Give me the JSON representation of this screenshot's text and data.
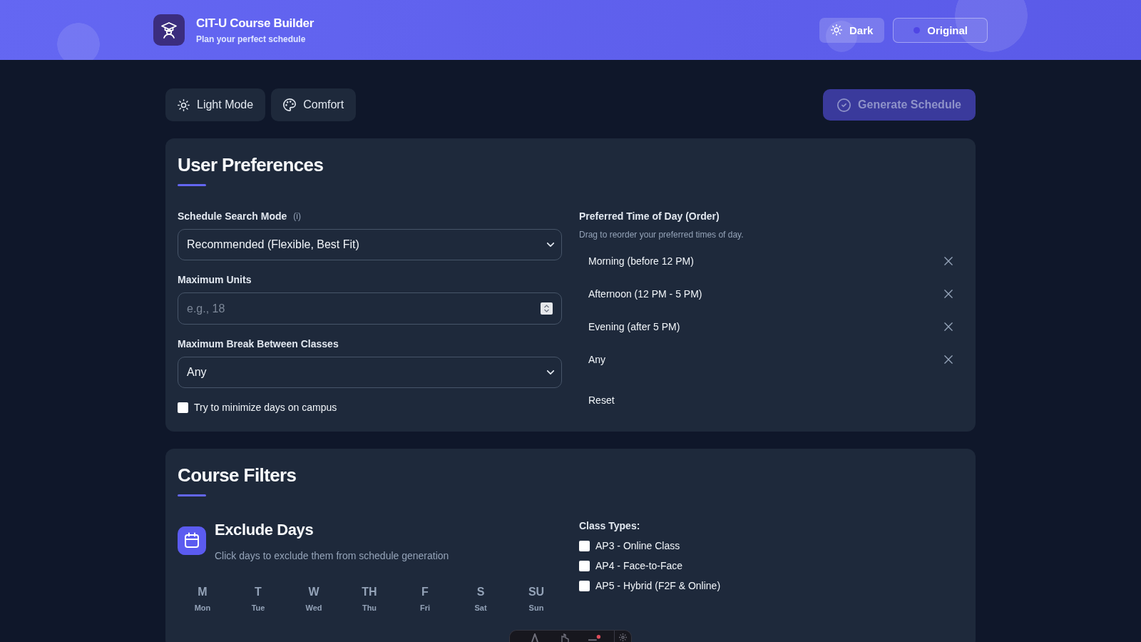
{
  "header": {
    "title": "CIT-U Course Builder",
    "subtitle": "Plan your perfect schedule",
    "buttons": [
      {
        "label": "Dark"
      },
      {
        "label": "Original"
      }
    ]
  },
  "toolbar": {
    "buttons": [
      {
        "label": "Light Mode"
      },
      {
        "label": "Comfort"
      }
    ],
    "generate": {
      "label": "Generate Schedule",
      "disabled": true
    }
  },
  "preferences": {
    "title": "User Preferences",
    "fields": [
      {
        "kind": "select",
        "label": "Schedule Search Mode",
        "info": "(i)",
        "value": "Recommended (Flexible, Best Fit)"
      },
      {
        "kind": "number",
        "label": "Maximum Units",
        "placeholder": "e.g., 18"
      },
      {
        "kind": "select",
        "label": "Maximum Break Between Classes",
        "value": "Any"
      }
    ],
    "minimize_days": {
      "label": "Try to minimize days on campus",
      "checked": false
    },
    "time_of_day": {
      "title": "Preferred Time of Day (Order)",
      "hint": "Drag to reorder your preferred times of day.",
      "items": [
        "Morning (before 12 PM)",
        "Afternoon (12 PM - 5 PM)",
        "Evening (after 5 PM)",
        "Any"
      ],
      "reset": "Reset"
    }
  },
  "filters": {
    "title": "Course Filters",
    "exclude_days": {
      "title": "Exclude Days",
      "description": "Click days to exclude them from schedule generation",
      "days": [
        {
          "letter": "M",
          "name": "Mon",
          "selected": false
        },
        {
          "letter": "T",
          "name": "Tue",
          "selected": false
        },
        {
          "letter": "W",
          "name": "Wed",
          "selected": false
        },
        {
          "letter": "TH",
          "name": "Thu",
          "selected": false
        },
        {
          "letter": "F",
          "name": "Fri",
          "selected": false
        },
        {
          "letter": "S",
          "name": "Sat",
          "selected": false
        },
        {
          "letter": "SU",
          "name": "Sun",
          "selected": false
        }
      ]
    },
    "class_types": {
      "label": "Class Types:",
      "options": [
        {
          "label": "AP3 - Online Class",
          "checked": false
        },
        {
          "label": "AP4 - Face-to-Face",
          "checked": false
        },
        {
          "label": "AP5 - Hybrid (F2F & Online)",
          "checked": false
        }
      ]
    }
  }
}
